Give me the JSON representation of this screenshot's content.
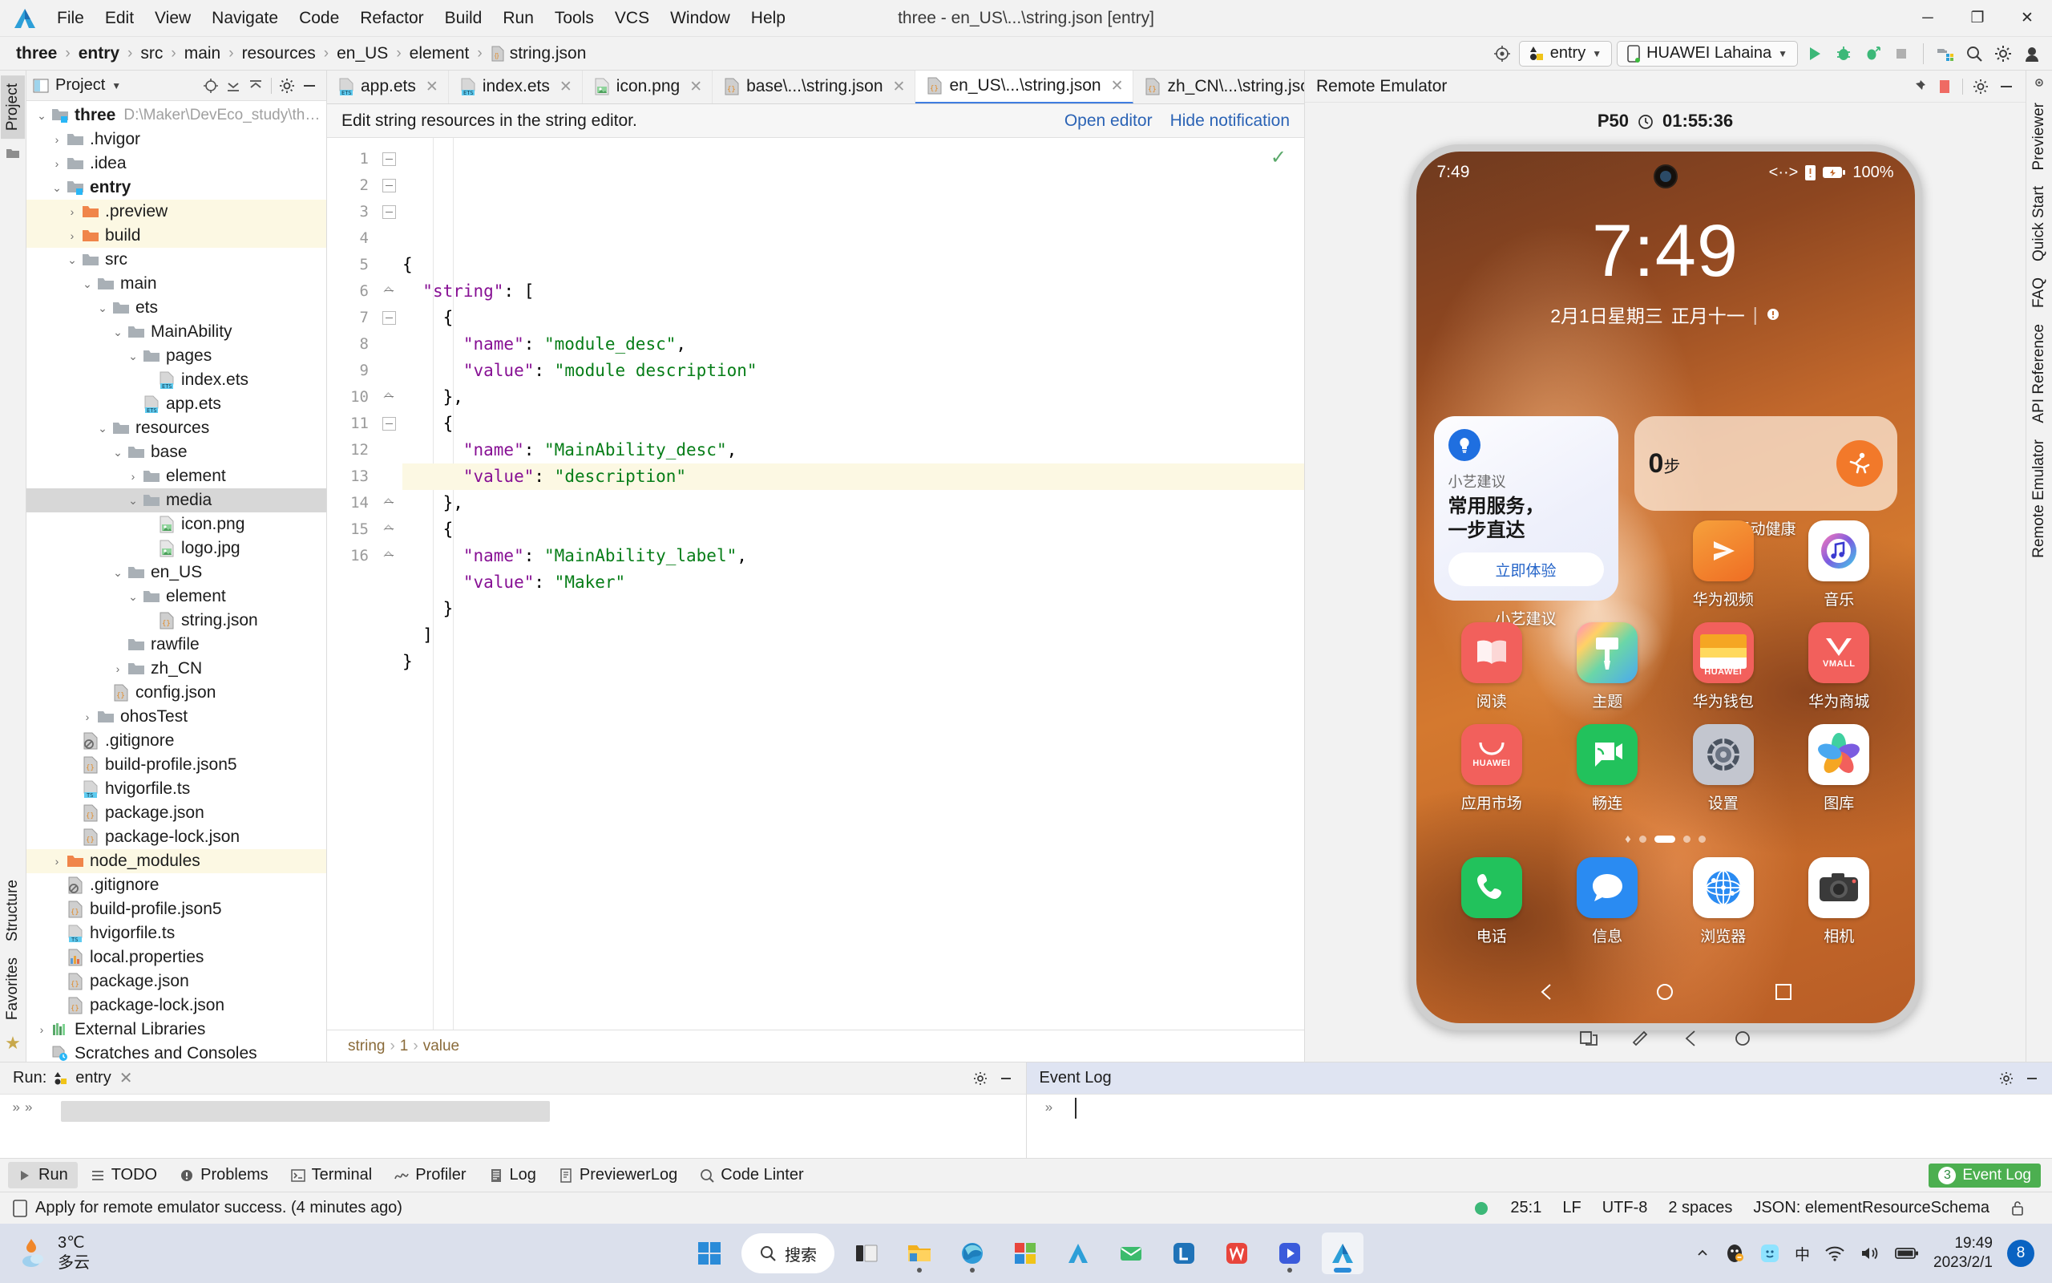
{
  "window": {
    "title": "three - en_US\\...\\string.json [entry]",
    "minimize": "─",
    "maximize": "❐",
    "close": "✕"
  },
  "menu": [
    "File",
    "Edit",
    "View",
    "Navigate",
    "Code",
    "Refactor",
    "Build",
    "Run",
    "Tools",
    "VCS",
    "Window",
    "Help"
  ],
  "breadcrumb": [
    "three",
    "entry",
    "src",
    "main",
    "resources",
    "en_US",
    "element",
    "string.json"
  ],
  "toolbar": {
    "module_config": "entry",
    "device": "HUAWEI Lahaina",
    "run_tip": "Run",
    "debug_tip": "Debug",
    "profile_tip": "Profile",
    "stop_tip": "Stop",
    "search_tip": "Search Everywhere",
    "settings_tip": "Settings"
  },
  "project_panel": {
    "title": "Project",
    "tree": [
      {
        "depth": 0,
        "arrow": "down",
        "icon": "module",
        "label": "three",
        "bold": true,
        "path": "D:\\Maker\\DevEco_study\\three",
        "hl": false
      },
      {
        "depth": 1,
        "arrow": "right",
        "icon": "folder",
        "label": ".hvigor",
        "bold": false,
        "path": "",
        "hl": false
      },
      {
        "depth": 1,
        "arrow": "right",
        "icon": "folder",
        "label": ".idea",
        "bold": false,
        "path": "",
        "hl": false
      },
      {
        "depth": 1,
        "arrow": "down",
        "icon": "module",
        "label": "entry",
        "bold": true,
        "path": "",
        "hl": false
      },
      {
        "depth": 2,
        "arrow": "right",
        "icon": "folder-orange",
        "label": ".preview",
        "bold": false,
        "path": "",
        "hl": true
      },
      {
        "depth": 2,
        "arrow": "right",
        "icon": "folder-orange",
        "label": "build",
        "bold": false,
        "path": "",
        "hl": true
      },
      {
        "depth": 2,
        "arrow": "down",
        "icon": "folder",
        "label": "src",
        "bold": false,
        "path": "",
        "hl": false
      },
      {
        "depth": 3,
        "arrow": "down",
        "icon": "folder",
        "label": "main",
        "bold": false,
        "path": "",
        "hl": false
      },
      {
        "depth": 4,
        "arrow": "down",
        "icon": "folder",
        "label": "ets",
        "bold": false,
        "path": "",
        "hl": false
      },
      {
        "depth": 5,
        "arrow": "down",
        "icon": "folder",
        "label": "MainAbility",
        "bold": false,
        "path": "",
        "hl": false
      },
      {
        "depth": 6,
        "arrow": "down",
        "icon": "folder",
        "label": "pages",
        "bold": false,
        "path": "",
        "hl": false
      },
      {
        "depth": 7,
        "arrow": "none",
        "icon": "ets",
        "label": "index.ets",
        "bold": false,
        "path": "",
        "hl": false
      },
      {
        "depth": 6,
        "arrow": "none",
        "icon": "ets",
        "label": "app.ets",
        "bold": false,
        "path": "",
        "hl": false
      },
      {
        "depth": 4,
        "arrow": "down",
        "icon": "folder",
        "label": "resources",
        "bold": false,
        "path": "",
        "hl": false
      },
      {
        "depth": 5,
        "arrow": "down",
        "icon": "folder",
        "label": "base",
        "bold": false,
        "path": "",
        "hl": false
      },
      {
        "depth": 6,
        "arrow": "right",
        "icon": "folder",
        "label": "element",
        "bold": false,
        "path": "",
        "hl": false
      },
      {
        "depth": 6,
        "arrow": "down",
        "icon": "folder",
        "label": "media",
        "bold": false,
        "path": "",
        "hl": false,
        "sel": true
      },
      {
        "depth": 7,
        "arrow": "none",
        "icon": "img",
        "label": "icon.png",
        "bold": false,
        "path": "",
        "hl": false
      },
      {
        "depth": 7,
        "arrow": "none",
        "icon": "img",
        "label": "logo.jpg",
        "bold": false,
        "path": "",
        "hl": false
      },
      {
        "depth": 5,
        "arrow": "down",
        "icon": "folder",
        "label": "en_US",
        "bold": false,
        "path": "",
        "hl": false
      },
      {
        "depth": 6,
        "arrow": "down",
        "icon": "folder",
        "label": "element",
        "bold": false,
        "path": "",
        "hl": false
      },
      {
        "depth": 7,
        "arrow": "none",
        "icon": "json",
        "label": "string.json",
        "bold": false,
        "path": "",
        "hl": false
      },
      {
        "depth": 5,
        "arrow": "none",
        "icon": "folder",
        "label": "rawfile",
        "bold": false,
        "path": "",
        "hl": false
      },
      {
        "depth": 5,
        "arrow": "right",
        "icon": "folder",
        "label": "zh_CN",
        "bold": false,
        "path": "",
        "hl": false
      },
      {
        "depth": 4,
        "arrow": "none",
        "icon": "json",
        "label": "config.json",
        "bold": false,
        "path": "",
        "hl": false
      },
      {
        "depth": 3,
        "arrow": "right",
        "icon": "folder",
        "label": "ohosTest",
        "bold": false,
        "path": "",
        "hl": false
      },
      {
        "depth": 2,
        "arrow": "none",
        "icon": "git",
        "label": ".gitignore",
        "bold": false,
        "path": "",
        "hl": false
      },
      {
        "depth": 2,
        "arrow": "none",
        "icon": "json",
        "label": "build-profile.json5",
        "bold": false,
        "path": "",
        "hl": false
      },
      {
        "depth": 2,
        "arrow": "none",
        "icon": "ts",
        "label": "hvigorfile.ts",
        "bold": false,
        "path": "",
        "hl": false
      },
      {
        "depth": 2,
        "arrow": "none",
        "icon": "json",
        "label": "package.json",
        "bold": false,
        "path": "",
        "hl": false
      },
      {
        "depth": 2,
        "arrow": "none",
        "icon": "json",
        "label": "package-lock.json",
        "bold": false,
        "path": "",
        "hl": false
      },
      {
        "depth": 1,
        "arrow": "right",
        "icon": "folder-orange",
        "label": "node_modules",
        "bold": false,
        "path": "",
        "hl": true
      },
      {
        "depth": 1,
        "arrow": "none",
        "icon": "git",
        "label": ".gitignore",
        "bold": false,
        "path": "",
        "hl": false
      },
      {
        "depth": 1,
        "arrow": "none",
        "icon": "json",
        "label": "build-profile.json5",
        "bold": false,
        "path": "",
        "hl": false
      },
      {
        "depth": 1,
        "arrow": "none",
        "icon": "ts",
        "label": "hvigorfile.ts",
        "bold": false,
        "path": "",
        "hl": false
      },
      {
        "depth": 1,
        "arrow": "none",
        "icon": "props",
        "label": "local.properties",
        "bold": false,
        "path": "",
        "hl": false
      },
      {
        "depth": 1,
        "arrow": "none",
        "icon": "json",
        "label": "package.json",
        "bold": false,
        "path": "",
        "hl": false
      },
      {
        "depth": 1,
        "arrow": "none",
        "icon": "json",
        "label": "package-lock.json",
        "bold": false,
        "path": "",
        "hl": false
      },
      {
        "depth": 0,
        "arrow": "right",
        "icon": "libs",
        "label": "External Libraries",
        "bold": false,
        "path": "",
        "hl": false
      },
      {
        "depth": 0,
        "arrow": "none",
        "icon": "scratch",
        "label": "Scratches and Consoles",
        "bold": false,
        "path": "",
        "hl": false
      }
    ]
  },
  "editor": {
    "tabs": [
      {
        "label": "app.ets",
        "icon": "ets",
        "active": false
      },
      {
        "label": "index.ets",
        "icon": "ets",
        "active": false
      },
      {
        "label": "icon.png",
        "icon": "img",
        "active": false
      },
      {
        "label": "base\\...\\string.json",
        "icon": "json",
        "active": false
      },
      {
        "label": "en_US\\...\\string.json",
        "icon": "json",
        "active": true
      },
      {
        "label": "zh_CN\\...\\string.json",
        "icon": "json",
        "active": false
      }
    ],
    "notification": {
      "message": "Edit string resources in the string editor.",
      "open_editor": "Open editor",
      "hide_notification": "Hide notification"
    },
    "lines": [
      {
        "n": 1,
        "text": "{",
        "fold": "start",
        "hl": false
      },
      {
        "n": 2,
        "text": "  \"string\": [",
        "fold": "start",
        "hl": false
      },
      {
        "n": 3,
        "text": "    {",
        "fold": "start",
        "hl": false
      },
      {
        "n": 4,
        "text": "      \"name\": \"module_desc\",",
        "fold": "none",
        "hl": false
      },
      {
        "n": 5,
        "text": "      \"value\": \"module description\"",
        "fold": "none",
        "hl": false
      },
      {
        "n": 6,
        "text": "    },",
        "fold": "end",
        "hl": false
      },
      {
        "n": 7,
        "text": "    {",
        "fold": "start",
        "hl": false
      },
      {
        "n": 8,
        "text": "      \"name\": \"MainAbility_desc\",",
        "fold": "none",
        "hl": false
      },
      {
        "n": 9,
        "text": "      \"value\": \"description\"",
        "fold": "none",
        "hl": true
      },
      {
        "n": 10,
        "text": "    },",
        "fold": "end",
        "hl": false
      },
      {
        "n": 11,
        "text": "    {",
        "fold": "start",
        "hl": false
      },
      {
        "n": 12,
        "text": "      \"name\": \"MainAbility_label\",",
        "fold": "none",
        "hl": false
      },
      {
        "n": 13,
        "text": "      \"value\": \"Maker\"",
        "fold": "none",
        "hl": false
      },
      {
        "n": 14,
        "text": "    }",
        "fold": "end",
        "hl": false
      },
      {
        "n": 15,
        "text": "  ]",
        "fold": "end",
        "hl": false
      },
      {
        "n": 16,
        "text": "}",
        "fold": "end",
        "hl": false
      }
    ],
    "bottom_breadcrumb": [
      "string",
      "1",
      "value"
    ]
  },
  "emulator": {
    "title": "Remote Emulator",
    "device_name": "P50",
    "remaining_time": "01:55:36",
    "phone": {
      "status_time": "7:49",
      "battery": "100%",
      "clock": "7:49",
      "date": "2月1日星期三",
      "lunar": "正月十一",
      "xiaoyi": {
        "tag": "小艺建议",
        "headline_1": "常用服务，",
        "headline_2": "一步直达",
        "button": "立即体验",
        "label": "小艺建议"
      },
      "health": {
        "steps": "0",
        "steps_unit": "步",
        "label": "运动健康"
      },
      "apps": [
        [
          {
            "name": "",
            "icon": "blank",
            "blank": true
          },
          {
            "name": "",
            "icon": "blank",
            "blank": true
          },
          {
            "name": "华为视频",
            "icon": "hw-video"
          },
          {
            "name": "音乐",
            "icon": "music"
          }
        ],
        [
          {
            "name": "阅读",
            "icon": "reader"
          },
          {
            "name": "主题",
            "icon": "theme"
          },
          {
            "name": "华为钱包",
            "icon": "wallet"
          },
          {
            "name": "华为商城",
            "icon": "vmall"
          }
        ],
        [
          {
            "name": "应用市场",
            "icon": "appgallery"
          },
          {
            "name": "畅连",
            "icon": "meetime"
          },
          {
            "name": "设置",
            "icon": "settings"
          },
          {
            "name": "图库",
            "icon": "gallery"
          }
        ],
        [
          {
            "name": "电话",
            "icon": "phone"
          },
          {
            "name": "信息",
            "icon": "messages"
          },
          {
            "name": "浏览器",
            "icon": "browser"
          },
          {
            "name": "相机",
            "icon": "camera"
          }
        ]
      ],
      "page_dots": 4,
      "active_dot": 1
    }
  },
  "bottom_panels": {
    "run": {
      "title": "Run:",
      "config": "entry"
    },
    "event_log": {
      "title": "Event Log"
    }
  },
  "tool_strip": {
    "items": [
      {
        "label": "Run",
        "icon": "run",
        "selected": true
      },
      {
        "label": "TODO",
        "icon": "todo",
        "selected": false
      },
      {
        "label": "Problems",
        "icon": "problems",
        "selected": false
      },
      {
        "label": "Terminal",
        "icon": "terminal",
        "selected": false
      },
      {
        "label": "Profiler",
        "icon": "profiler",
        "selected": false
      },
      {
        "label": "Log",
        "icon": "log",
        "selected": false
      },
      {
        "label": "PreviewerLog",
        "icon": "previewerlog",
        "selected": false
      },
      {
        "label": "Code Linter",
        "icon": "linter",
        "selected": false
      }
    ],
    "event_log_badge": "Event Log",
    "event_log_count": "3"
  },
  "status_bar": {
    "message": "Apply for remote emulator success. (4 minutes ago)",
    "caret": "25:1",
    "line_sep": "LF",
    "encoding": "UTF-8",
    "indent": "2 spaces",
    "schema": "JSON: elementResourceSchema"
  },
  "right_strip": [
    "Previewer",
    "Quick Start",
    "FAQ",
    "API Reference",
    "Remote Emulator"
  ],
  "left_strip_top": [
    "Project"
  ],
  "left_strip_bottom": [
    "Structure",
    "Favorites"
  ],
  "taskbar": {
    "weather_temp": "3℃",
    "weather_desc": "多云",
    "search_placeholder": "搜索",
    "time": "19:49",
    "date": "2023/2/1",
    "notif_count": "8",
    "ime": "中",
    "apps": [
      {
        "name": "start",
        "label": "Start"
      },
      {
        "name": "search",
        "label": "搜索"
      },
      {
        "name": "taskview",
        "label": "Task View"
      },
      {
        "name": "explorer",
        "label": "File Explorer"
      },
      {
        "name": "edge",
        "label": "Microsoft Edge"
      },
      {
        "name": "store",
        "label": "Microsoft Store"
      },
      {
        "name": "ide2",
        "label": "DevEco"
      },
      {
        "name": "mail",
        "label": "Mail"
      },
      {
        "name": "app-l",
        "label": "App"
      },
      {
        "name": "app-w",
        "label": "WPS"
      },
      {
        "name": "app-v",
        "label": "Video"
      },
      {
        "name": "deveco",
        "label": "DevEco Studio"
      }
    ]
  }
}
